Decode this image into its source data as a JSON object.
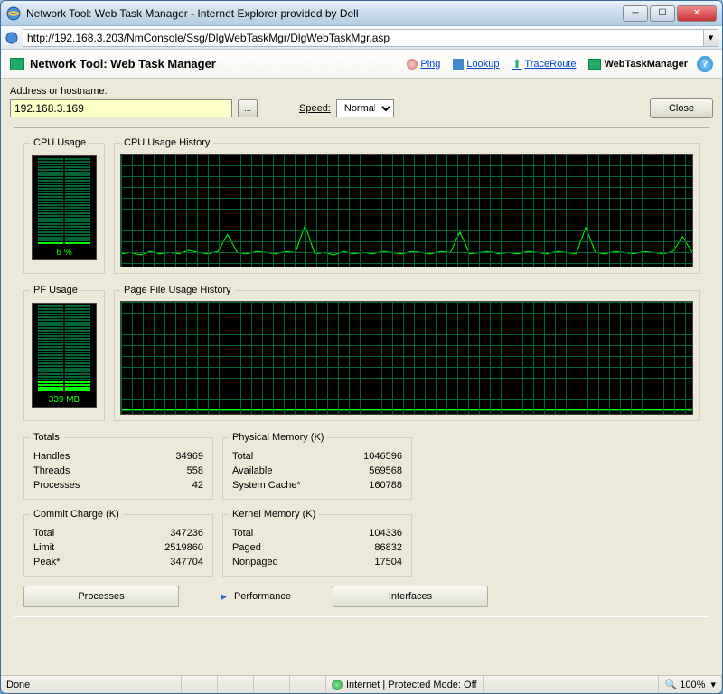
{
  "window": {
    "title": "Network Tool: Web Task Manager - Internet Explorer provided by Dell",
    "url": "http://192.168.3.203/NmConsole/Ssg/DlgWebTaskMgr/DlgWebTaskMgr.asp"
  },
  "toolbar": {
    "title": "Network Tool: Web Task Manager",
    "ping": "Ping",
    "lookup": "Lookup",
    "traceroute": "TraceRoute",
    "wtm": "WebTaskManager"
  },
  "inputs": {
    "address_label": "Address or hostname:",
    "address_value": "192.168.3.169",
    "speed_label": "Speed:",
    "speed_value": "Normal",
    "close_label": "Close"
  },
  "cpu": {
    "meter_title": "CPU Usage",
    "meter_value": "6 %",
    "history_title": "CPU Usage History"
  },
  "pf": {
    "meter_title": "PF Usage",
    "meter_value": "339 MB",
    "history_title": "Page File Usage History"
  },
  "totals": {
    "title": "Totals",
    "handles_label": "Handles",
    "handles": "34969",
    "threads_label": "Threads",
    "threads": "558",
    "processes_label": "Processes",
    "processes": "42"
  },
  "physmem": {
    "title": "Physical Memory (K)",
    "total_label": "Total",
    "total": "1046596",
    "avail_label": "Available",
    "avail": "569568",
    "cache_label": "System Cache*",
    "cache": "160788"
  },
  "commit": {
    "title": "Commit Charge (K)",
    "total_label": "Total",
    "total": "347236",
    "limit_label": "Limit",
    "limit": "2519860",
    "peak_label": "Peak*",
    "peak": "347704"
  },
  "kernel": {
    "title": "Kernel Memory (K)",
    "total_label": "Total",
    "total": "104336",
    "paged_label": "Paged",
    "paged": "86832",
    "nonpaged_label": "Nonpaged",
    "nonpaged": "17504"
  },
  "tabs": {
    "processes": "Processes",
    "performance": "Performance",
    "interfaces": "Interfaces"
  },
  "status": {
    "done": "Done",
    "zone": "Internet | Protected Mode: Off",
    "zoom": "100%"
  },
  "chart_data": [
    {
      "type": "line",
      "title": "CPU Usage History",
      "ylabel": "CPU %",
      "ylim": [
        0,
        100
      ],
      "x": [
        0,
        1,
        2,
        3,
        4,
        5,
        6,
        7,
        8,
        9,
        10,
        11,
        12,
        13,
        14,
        15,
        16,
        17,
        18,
        19,
        20,
        21,
        22,
        23,
        24,
        25,
        26,
        27,
        28,
        29,
        30,
        31,
        32,
        33,
        34,
        35,
        36,
        37,
        38,
        39,
        40,
        41,
        42,
        43,
        44,
        45,
        46,
        47,
        48,
        49,
        50,
        51,
        52,
        53,
        54,
        55,
        56,
        57,
        58,
        59
      ],
      "values": [
        5,
        6,
        4,
        7,
        5,
        6,
        5,
        8,
        6,
        5,
        7,
        22,
        6,
        5,
        7,
        6,
        5,
        7,
        6,
        30,
        5,
        6,
        4,
        7,
        5,
        6,
        5,
        7,
        6,
        5,
        7,
        6,
        5,
        7,
        6,
        24,
        5,
        6,
        7,
        5,
        6,
        5,
        7,
        6,
        5,
        7,
        6,
        5,
        28,
        6,
        5,
        7,
        6,
        5,
        7,
        6,
        5,
        7,
        20,
        6
      ]
    },
    {
      "type": "line",
      "title": "Page File Usage History",
      "ylabel": "MB",
      "ylim": [
        0,
        2520
      ],
      "x": [
        0,
        10,
        20,
        30,
        40,
        50,
        60
      ],
      "values": [
        339,
        339,
        339,
        339,
        339,
        339,
        339
      ]
    }
  ]
}
